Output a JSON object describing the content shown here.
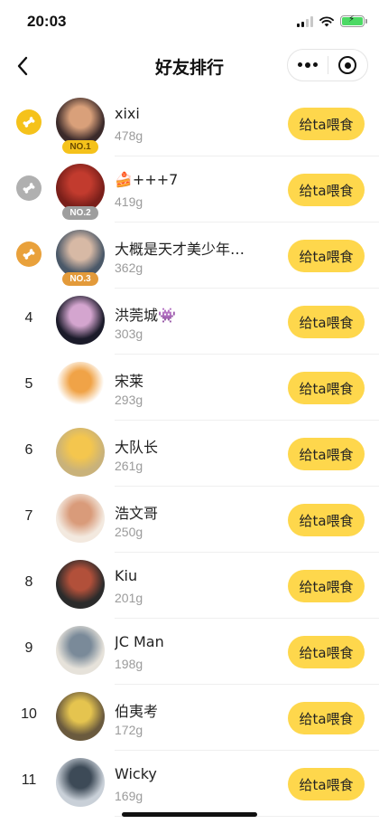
{
  "status_bar": {
    "time": "20:03"
  },
  "nav": {
    "title": "好友排行"
  },
  "colors": {
    "feed_button": "#fed74c",
    "gold_medal": "#f5c21b",
    "silver_medal": "#b0b0b0",
    "bronze_medal": "#e9a13b",
    "battery": "#4cd964"
  },
  "feed_button_label": "给ta喂食",
  "friends": [
    {
      "rank": "1",
      "badge": "NO.1",
      "medal": "gold",
      "name": "xixi",
      "weight": "478g",
      "avatar_colors": [
        "#3b2a2a",
        "#d9a07a"
      ]
    },
    {
      "rank": "2",
      "badge": "NO.2",
      "medal": "silver",
      "name": "🍰+++7",
      "weight": "419g",
      "avatar_colors": [
        "#7a1f1a",
        "#c23b2e"
      ]
    },
    {
      "rank": "3",
      "badge": "NO.3",
      "medal": "bronze",
      "name": "大概是天才美少年…",
      "weight": "362g",
      "avatar_colors": [
        "#4a5868",
        "#d7b9a5"
      ]
    },
    {
      "rank": "4",
      "badge": "",
      "medal": "",
      "name": "洪莞城👾",
      "weight": "303g",
      "avatar_colors": [
        "#1b1b2a",
        "#d4a5cf"
      ]
    },
    {
      "rank": "5",
      "badge": "",
      "medal": "",
      "name": "宋莱",
      "weight": "293g",
      "avatar_colors": [
        "#ffffff",
        "#f0a347"
      ]
    },
    {
      "rank": "6",
      "badge": "",
      "medal": "",
      "name": "大队长",
      "weight": "261g",
      "avatar_colors": [
        "#c9b27a",
        "#f4c64e"
      ]
    },
    {
      "rank": "7",
      "badge": "",
      "medal": "",
      "name": "浩文哥",
      "weight": "250g",
      "avatar_colors": [
        "#f3e9df",
        "#d99b7a"
      ]
    },
    {
      "rank": "8",
      "badge": "",
      "medal": "",
      "name": "Kiu",
      "weight": "201g",
      "avatar_colors": [
        "#2b2b2b",
        "#b2503a"
      ]
    },
    {
      "rank": "9",
      "badge": "",
      "medal": "",
      "name": "JC Man",
      "weight": "198g",
      "avatar_colors": [
        "#e6e2da",
        "#7a8a99"
      ]
    },
    {
      "rank": "10",
      "badge": "",
      "medal": "",
      "name": "伯夷考",
      "weight": "172g",
      "avatar_colors": [
        "#6a5a3e",
        "#e5c44f"
      ]
    },
    {
      "rank": "11",
      "badge": "",
      "medal": "",
      "name": "Wicky",
      "weight": "169g",
      "avatar_colors": [
        "#c9d0d8",
        "#3d4a57"
      ]
    }
  ]
}
